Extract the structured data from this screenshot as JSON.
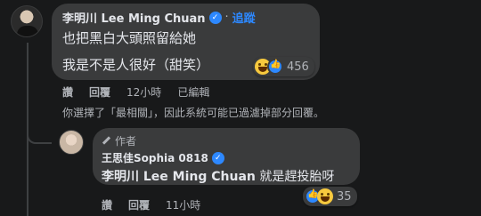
{
  "comment": {
    "author": "李明川 Lee Ming Chuan",
    "follow_label": "追蹤",
    "separator": "·",
    "lines": [
      "也把黑白大頭照留給她",
      "我是不是人很好（甜笑）"
    ],
    "reaction_count": "456",
    "actions": {
      "like": "讚",
      "reply": "回覆",
      "time": "12小時",
      "edited": "已編輯"
    }
  },
  "notice": "你選擇了「最相關」，因此系統可能已過濾掉部分回覆。",
  "reply": {
    "badge": "作者",
    "author": "王思佳Sophia 0818",
    "mention": "李明川 Lee Ming Chuan",
    "text": " 就是趕投胎呀",
    "reaction_count": "35",
    "actions": {
      "like": "讚",
      "reply": "回覆",
      "time": "11小時"
    }
  },
  "colors": {
    "background": "#18191a",
    "bubble": "#3a3b3c",
    "accent": "#2d88ff",
    "muted": "#b0b3b8"
  },
  "icons": [
    "verified-badge-icon",
    "haha-reaction-icon",
    "like-reaction-icon",
    "pencil-icon"
  ]
}
